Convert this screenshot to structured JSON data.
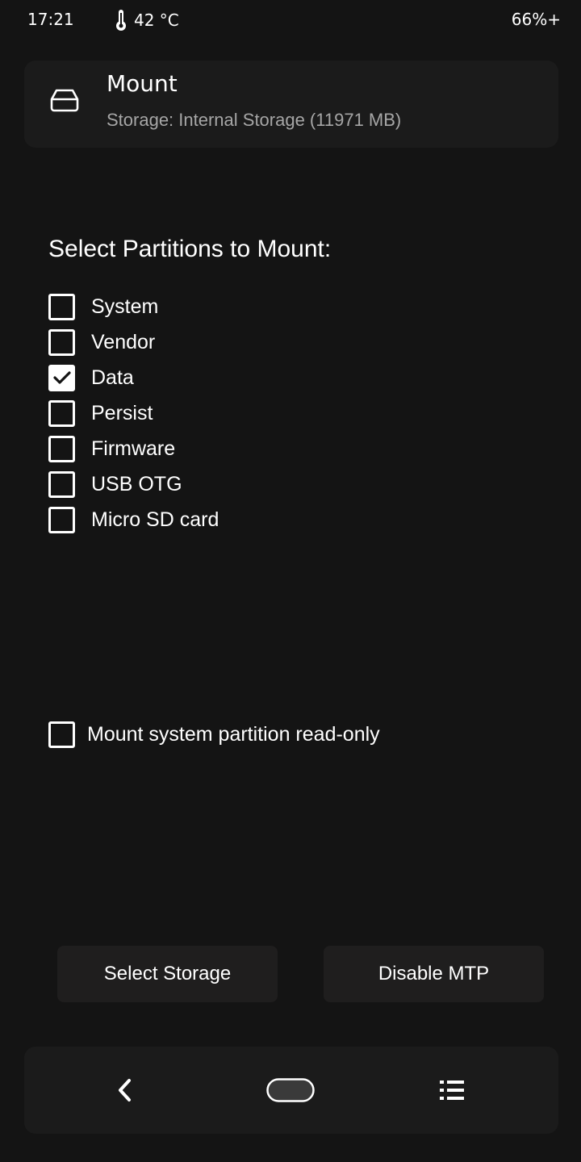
{
  "status_bar": {
    "time": "17:21",
    "temperature": "42 °C",
    "battery": "66%+"
  },
  "header": {
    "title": "Mount",
    "subtitle": "Storage: Internal Storage (11971 MB)",
    "icon": "drive-icon"
  },
  "partitions": {
    "heading": "Select Partitions to Mount:",
    "items": [
      {
        "label": "System",
        "checked": false
      },
      {
        "label": "Vendor",
        "checked": false
      },
      {
        "label": "Data",
        "checked": true
      },
      {
        "label": "Persist",
        "checked": false
      },
      {
        "label": "Firmware",
        "checked": false
      },
      {
        "label": "USB OTG",
        "checked": false
      },
      {
        "label": "Micro SD card",
        "checked": false
      }
    ]
  },
  "options": {
    "readonly_label": "Mount system partition read-only",
    "readonly_checked": false
  },
  "buttons": {
    "select_storage": "Select Storage",
    "disable_mtp": "Disable MTP"
  },
  "nav": {
    "back_icon": "chevron-left-icon",
    "home_icon": "home-pill-icon",
    "menu_icon": "list-menu-icon"
  },
  "colors": {
    "background": "#141414",
    "card": "#1b1b1b",
    "button": "#1f1e1e",
    "text": "#ffffff",
    "subtext": "#a6a6a6"
  }
}
